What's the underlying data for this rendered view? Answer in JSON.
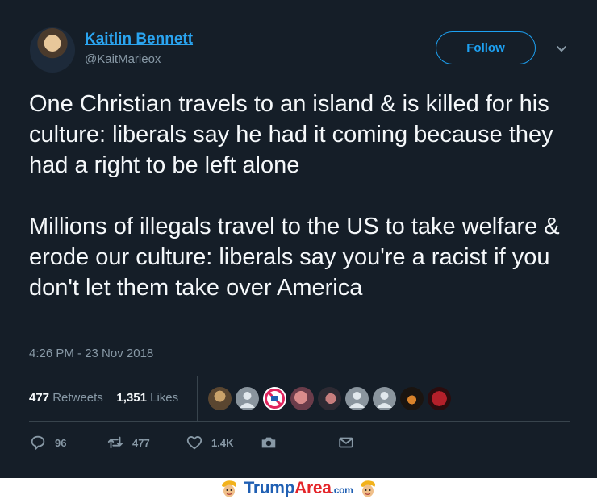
{
  "user": {
    "display_name": "Kaitlin Bennett",
    "handle": "@KaitMarieox",
    "follow_label": "Follow"
  },
  "tweet": {
    "paragraph_1": "One Christian travels to an island & is killed for his culture: liberals say he had it coming because they had a right to be left alone",
    "paragraph_2": "Millions of illegals travel to the US to take welfare & erode our culture: liberals say you're a racist if you don't let them take over America",
    "timestamp": "4:26 PM - 23 Nov 2018"
  },
  "stats": {
    "retweets_count": "477",
    "retweets_label": "Retweets",
    "likes_count": "1,351",
    "likes_label": "Likes"
  },
  "actions": {
    "reply_count": "96",
    "retweet_count": "477",
    "like_count": "1.4K"
  },
  "footer": {
    "brand_trump": "Trump",
    "brand_area": "Area",
    "brand_suffix": ".com"
  },
  "colors": {
    "background": "#151e28",
    "accent": "#1da1f2",
    "muted": "#8899a6"
  }
}
